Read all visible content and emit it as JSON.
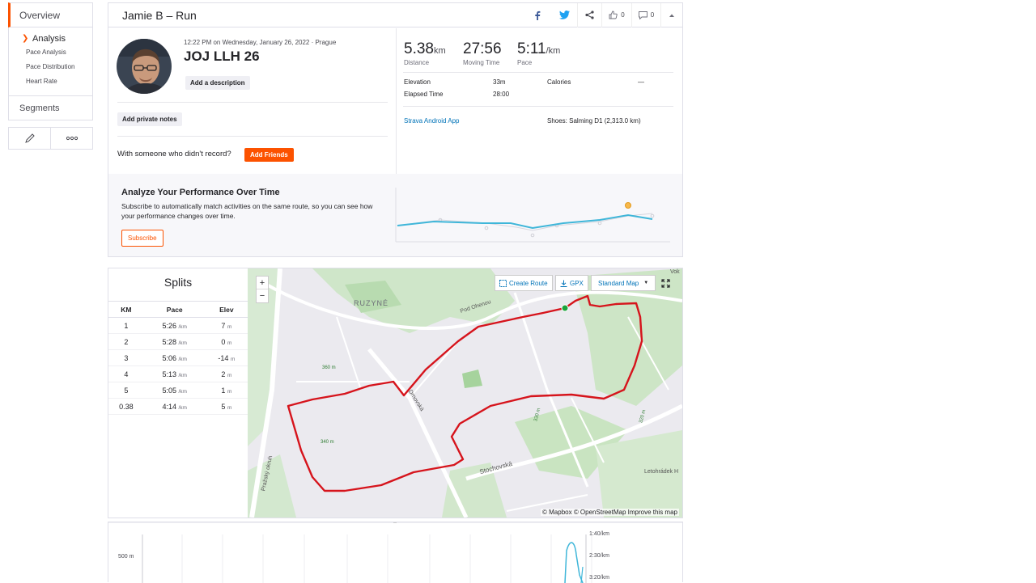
{
  "sidebar": {
    "overview": "Overview",
    "analysis": "Analysis",
    "sub_items": [
      "Pace Analysis",
      "Pace Distribution",
      "Heart Rate"
    ],
    "segments": "Segments"
  },
  "activity": {
    "title": "Jamie B – Run",
    "kudos_count": "0",
    "comment_count": "0",
    "datetime": "12:22 PM on Wednesday, January 26, 2022 · Prague",
    "name": "JOJ LLH 26",
    "add_description": "Add a description",
    "add_private_notes": "Add private notes",
    "with_someone": "With someone who didn't record?",
    "add_friends": "Add Friends",
    "stats": {
      "distance_value": "5.38",
      "distance_unit": "km",
      "distance_label": "Distance",
      "moving_time_value": "27:56",
      "moving_time_label": "Moving Time",
      "pace_value": "5:11",
      "pace_unit": "/km",
      "pace_label": "Pace"
    },
    "details": {
      "elevation_label": "Elevation",
      "elevation_value": "33m",
      "calories_label": "Calories",
      "calories_value": "—",
      "elapsed_label": "Elapsed Time",
      "elapsed_value": "28:00",
      "device": "Strava Android App",
      "shoes": "Shoes: Salming D1 (2,313.0 km)"
    }
  },
  "performance": {
    "title": "Analyze Your Performance Over Time",
    "text": "Subscribe to automatically match activities on the same route, so you can see how your performance changes over time.",
    "subscribe": "Subscribe"
  },
  "splits": {
    "title": "Splits",
    "headers": [
      "KM",
      "Pace",
      "Elev"
    ],
    "rows": [
      {
        "km": "1",
        "pace": "5:26",
        "unit": "/km",
        "elev": "7",
        "elev_unit": "m"
      },
      {
        "km": "2",
        "pace": "5:28",
        "unit": "/km",
        "elev": "0",
        "elev_unit": "m"
      },
      {
        "km": "3",
        "pace": "5:06",
        "unit": "/km",
        "elev": "-14",
        "elev_unit": "m"
      },
      {
        "km": "4",
        "pace": "5:13",
        "unit": "/km",
        "elev": "2",
        "elev_unit": "m"
      },
      {
        "km": "5",
        "pace": "5:05",
        "unit": "/km",
        "elev": "1",
        "elev_unit": "m"
      },
      {
        "km": "0.38",
        "pace": "4:14",
        "unit": "/km",
        "elev": "5",
        "elev_unit": "m"
      }
    ]
  },
  "map": {
    "zoom_in": "+",
    "zoom_out": "−",
    "create_route": "Create Route",
    "gpx": "GPX",
    "map_style": "Standard Map",
    "labels": {
      "ruzyne": "RUZYNÉ",
      "pod_ohenou": "Pod Ohenou",
      "drnovska": "Drnovská",
      "stochovska": "Stochovská",
      "prazsky_okruh": "Pražský okruh",
      "letohradek": "Letohrádek H",
      "vok": "Vok",
      "elev_360": "360 m",
      "elev_340": "340 m",
      "elev_330": "330 m",
      "elev_320": "320 m"
    },
    "attribution": "© Mapbox © OpenStreetMap Improve this map"
  },
  "elevation_chart": {
    "y_label": "500 m",
    "pace_ticks": [
      "1:40/km",
      "2:30/km",
      "3:20/km"
    ]
  },
  "colors": {
    "accent": "#fc5200",
    "route": "#d6141c",
    "trend_line": "#3fb6d9",
    "link": "#0073b8"
  }
}
